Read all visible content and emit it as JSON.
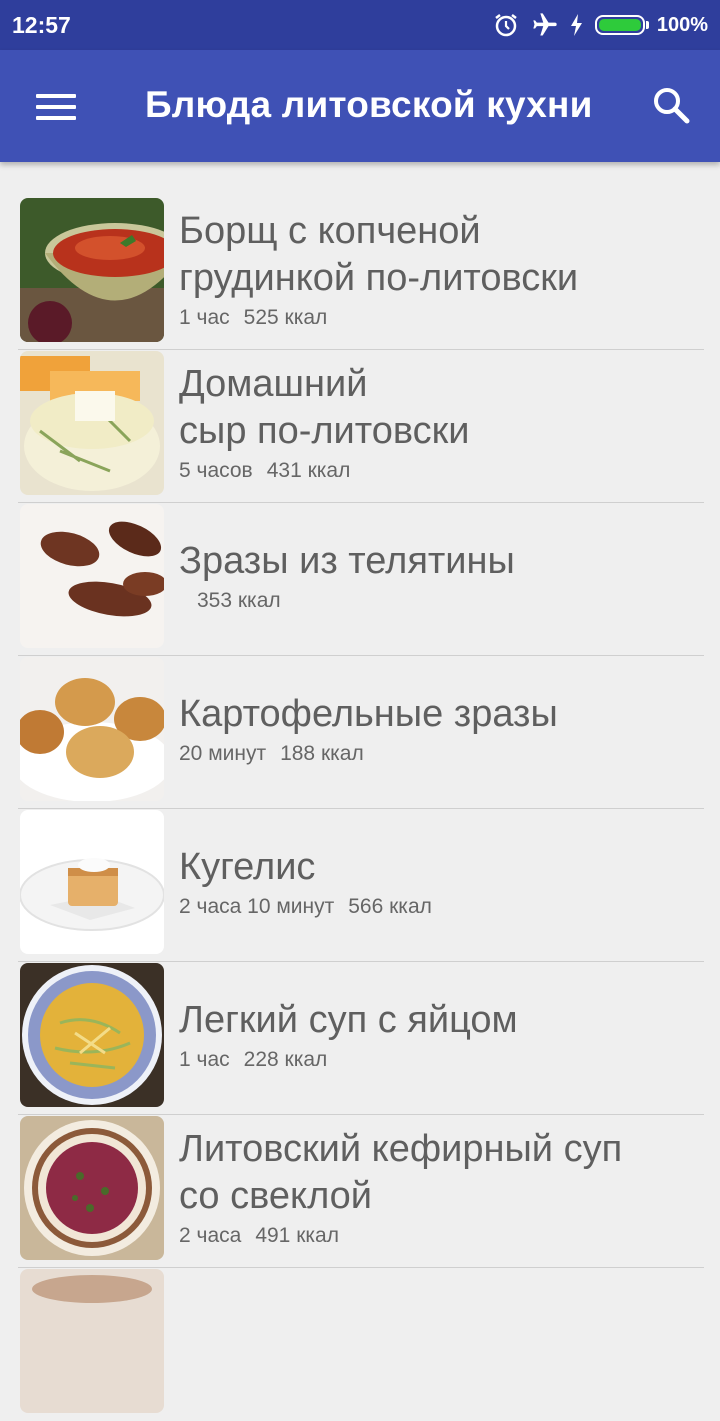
{
  "status": {
    "time": "12:57",
    "battery": "100%",
    "icons": [
      "alarm-icon",
      "airplane-icon",
      "charging-icon",
      "battery-icon"
    ]
  },
  "appbar": {
    "title": "Блюда литовской кухни",
    "menu_icon": "menu-icon",
    "search_icon": "search-icon"
  },
  "colors": {
    "statusbar": "#2f3e9c",
    "appbar": "#3f51b5",
    "background": "#efefef",
    "battery": "#2ecb3b"
  },
  "recipes": [
    {
      "line1": "Борщ с копченой",
      "line2": "грудинкой по-литовски",
      "time": "1 час",
      "kcal": "525 ккал"
    },
    {
      "line1": "Домашний",
      "line2": "сыр по-литовски",
      "time": "5 часов",
      "kcal": "431 ккал"
    },
    {
      "line1": "Зразы из телятины",
      "line2": "",
      "time": "",
      "kcal": "353 ккал"
    },
    {
      "line1": "Картофельные зразы",
      "line2": "",
      "time": "20 минут",
      "kcal": "188 ккал"
    },
    {
      "line1": "Кугелис",
      "line2": "",
      "time": "2 часа 10 минут",
      "kcal": "566 ккал"
    },
    {
      "line1": "Легкий суп с яйцом",
      "line2": "",
      "time": "1 час",
      "kcal": "228 ккал"
    },
    {
      "line1": "Литовский кефирный суп",
      "line2": "со свеклой",
      "time": "2 часа",
      "kcal": "491 ккал"
    }
  ]
}
